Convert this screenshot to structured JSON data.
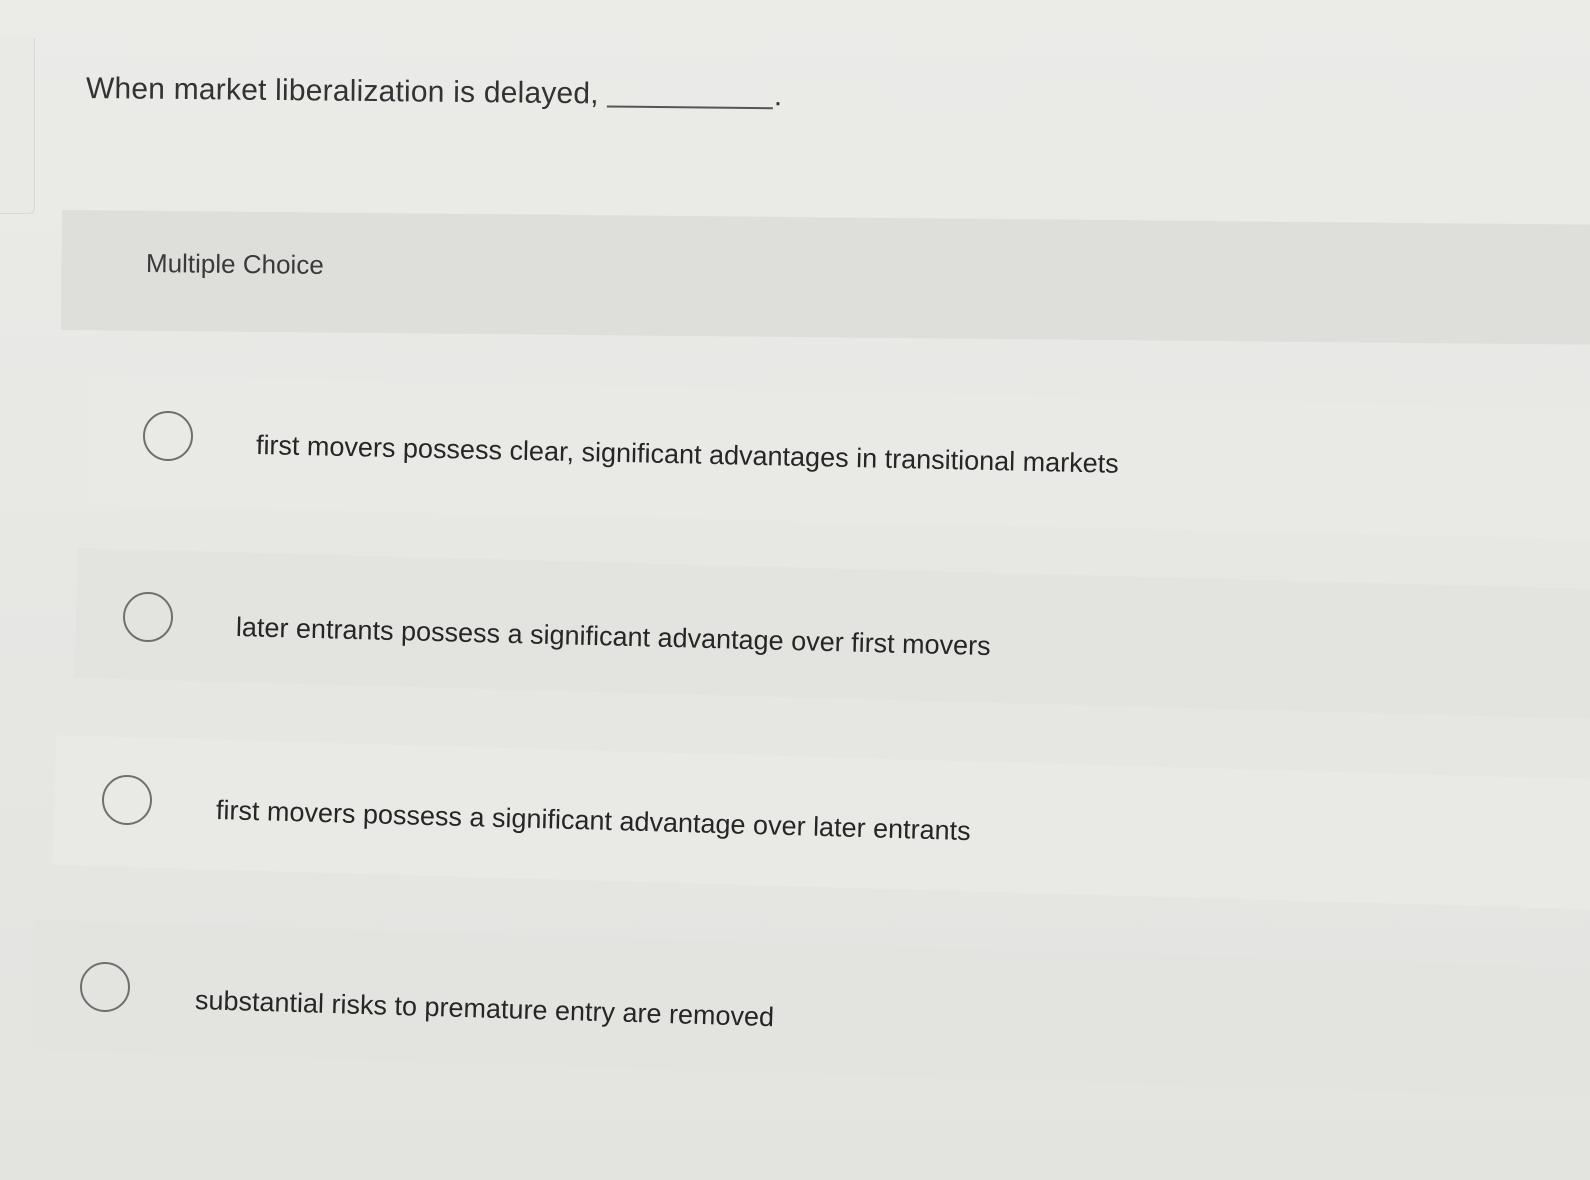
{
  "question": {
    "prompt": "When market liberalization is delayed,",
    "end_punct": "."
  },
  "section": {
    "label": "Multiple Choice"
  },
  "choices": [
    {
      "text": "first movers possess clear, significant advantages in transitional markets",
      "selected": false
    },
    {
      "text": "later entrants possess a significant advantage over first movers",
      "selected": false
    },
    {
      "text": "first movers possess a significant advantage over later entrants",
      "selected": false
    },
    {
      "text": "substantial risks to premature entry are removed",
      "selected": false
    }
  ]
}
